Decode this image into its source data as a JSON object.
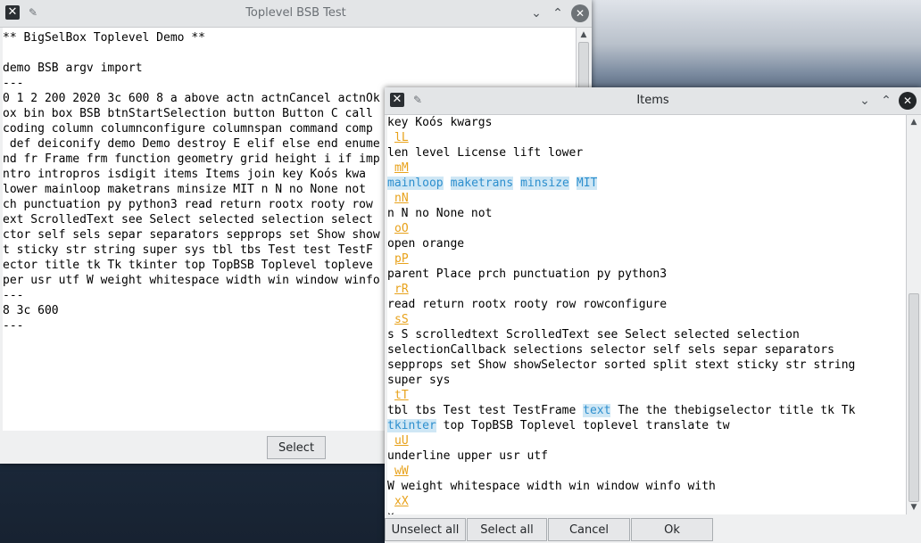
{
  "colors": {
    "letter_tag": "#e8a21b",
    "highlight_bg": "#cfe7f5",
    "highlight_fg": "#2d8fce"
  },
  "main_window": {
    "title": "Toplevel BSB Test",
    "icons": {
      "app": "app-icon",
      "pin": "pin-icon",
      "minimize": "chevron-down-icon",
      "maximize": "chevron-up-icon",
      "close": "close-icon"
    },
    "lines": [
      "** BigSelBox Toplevel Demo **",
      "",
      "demo BSB argv import",
      "---",
      "0 1 2 200 2020 3c 600 8 a above actn actnCancel actnOk",
      "ox bin box BSB btnStartSelection button Button C call",
      "coding column columnconfigure columnspan command comp",
      " def deiconify demo Demo destroy E elif else end enume",
      "nd fr Frame frm function geometry grid height i if imp",
      "ntro intropros isdigit items Items join key Koós kwa",
      "lower mainloop maketrans minsize MIT n N no None not",
      "ch punctuation py python3 read return rootx rooty row",
      "ext ScrolledText see Select selected selection select",
      "ctor self sels separ separators sepprops set Show show",
      "t sticky str string super sys tbl tbs Test test TestF",
      "ector title tk Tk tkinter top TopBSB Toplevel topleve",
      "per usr utf W weight whitespace width win window winfo",
      "---",
      "8 3c 600",
      "---"
    ],
    "select_button": "Select"
  },
  "items_window": {
    "title": "Items",
    "icons": {
      "app": "app-icon",
      "pin": "pin-icon",
      "minimize": "chevron-down-icon",
      "maximize": "chevron-up-icon",
      "close": "close-icon"
    },
    "rows": [
      {
        "kind": "words",
        "text": "key Koós kwargs"
      },
      {
        "kind": "tag",
        "text": "lL"
      },
      {
        "kind": "words",
        "text": "len level License lift lower"
      },
      {
        "kind": "tag",
        "text": "mM"
      },
      {
        "kind": "selected",
        "words": [
          "mainloop",
          "maketrans",
          "minsize",
          "MIT"
        ]
      },
      {
        "kind": "tag",
        "text": "nN"
      },
      {
        "kind": "words",
        "text": "n N no None not"
      },
      {
        "kind": "tag",
        "text": "oO"
      },
      {
        "kind": "words",
        "text": "open orange"
      },
      {
        "kind": "tag",
        "text": "pP"
      },
      {
        "kind": "words",
        "text": "parent Place prch punctuation py python3"
      },
      {
        "kind": "tag",
        "text": "rR"
      },
      {
        "kind": "words",
        "text": "read return rootx rooty row rowconfigure"
      },
      {
        "kind": "tag",
        "text": "sS"
      },
      {
        "kind": "words",
        "text": "s S scrolledtext ScrolledText see Select selected selection"
      },
      {
        "kind": "words",
        "text": "selectionCallback selections selector self sels separ separators"
      },
      {
        "kind": "words",
        "text": "sepprops set Show showSelector sorted split stext sticky str string"
      },
      {
        "kind": "words",
        "text": "super sys"
      },
      {
        "kind": "tag",
        "text": "tT"
      },
      {
        "kind": "mixed",
        "before": "tbl tbs Test test TestFrame ",
        "selected": "text",
        "after": " The the thebigselector title tk Tk"
      },
      {
        "kind": "mixed",
        "before": "",
        "selected": "tkinter",
        "after": " top TopBSB Toplevel toplevel translate tw"
      },
      {
        "kind": "tag",
        "text": "uU"
      },
      {
        "kind": "words",
        "text": "underline upper usr utf"
      },
      {
        "kind": "tag",
        "text": "wW"
      },
      {
        "kind": "words",
        "text": "W weight whitespace width win window winfo with"
      },
      {
        "kind": "tag",
        "text": "xX"
      },
      {
        "kind": "words",
        "text": "x"
      }
    ],
    "buttons": {
      "unselect_all": "Unselect all",
      "select_all": "Select all",
      "cancel": "Cancel",
      "ok": "Ok"
    }
  }
}
